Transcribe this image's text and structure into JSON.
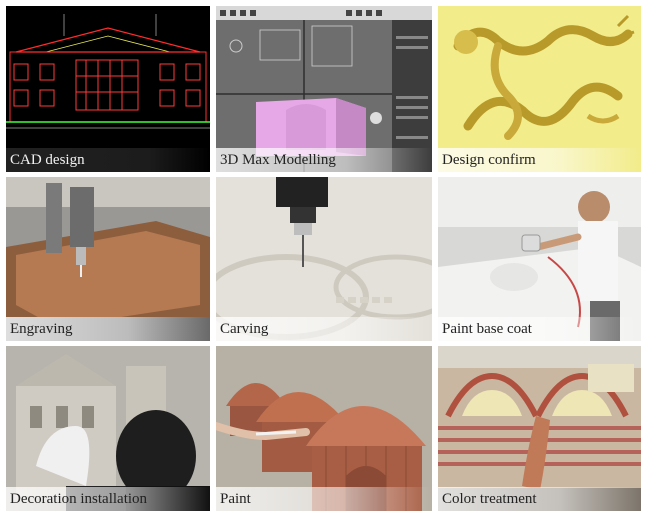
{
  "steps": [
    {
      "label": "CAD design"
    },
    {
      "label": "3D Max Modelling"
    },
    {
      "label": "Design confirm"
    },
    {
      "label": "Engraving"
    },
    {
      "label": "Carving"
    },
    {
      "label": "Paint base coat"
    },
    {
      "label": "Decoration installation"
    },
    {
      "label": "Paint"
    },
    {
      "label": "Color treatment"
    }
  ]
}
